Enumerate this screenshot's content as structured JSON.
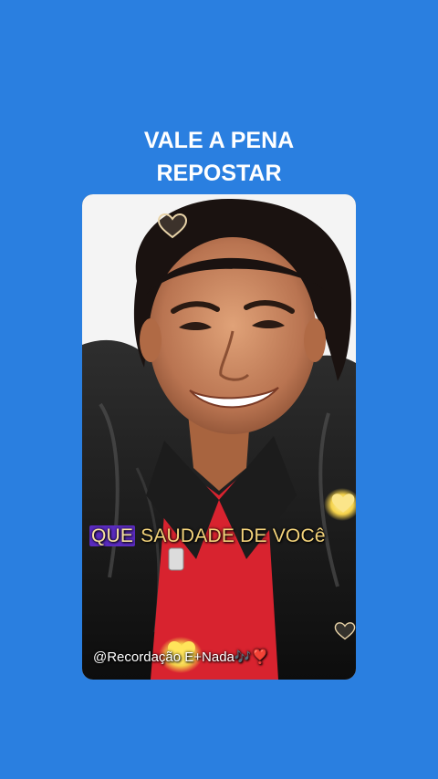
{
  "headline": {
    "line1": "VALE A PENA",
    "line2": "REPOSTAR"
  },
  "video": {
    "caption_highlight": "QUE",
    "caption_rest": " SAUDADE DE VOCê",
    "watermark": "@Recordação E+Nada🎶❣️"
  },
  "icons": {
    "top_heart": "heart-outline-icon",
    "right_heart": "heart-glow-icon",
    "bottom_heart": "heart-glow-icon",
    "corner_heart": "heart-outline-icon"
  },
  "colors": {
    "background": "#2a7fe0",
    "caption": "#f2d27a",
    "caption_highlight_bg": "#5a2bbf"
  }
}
